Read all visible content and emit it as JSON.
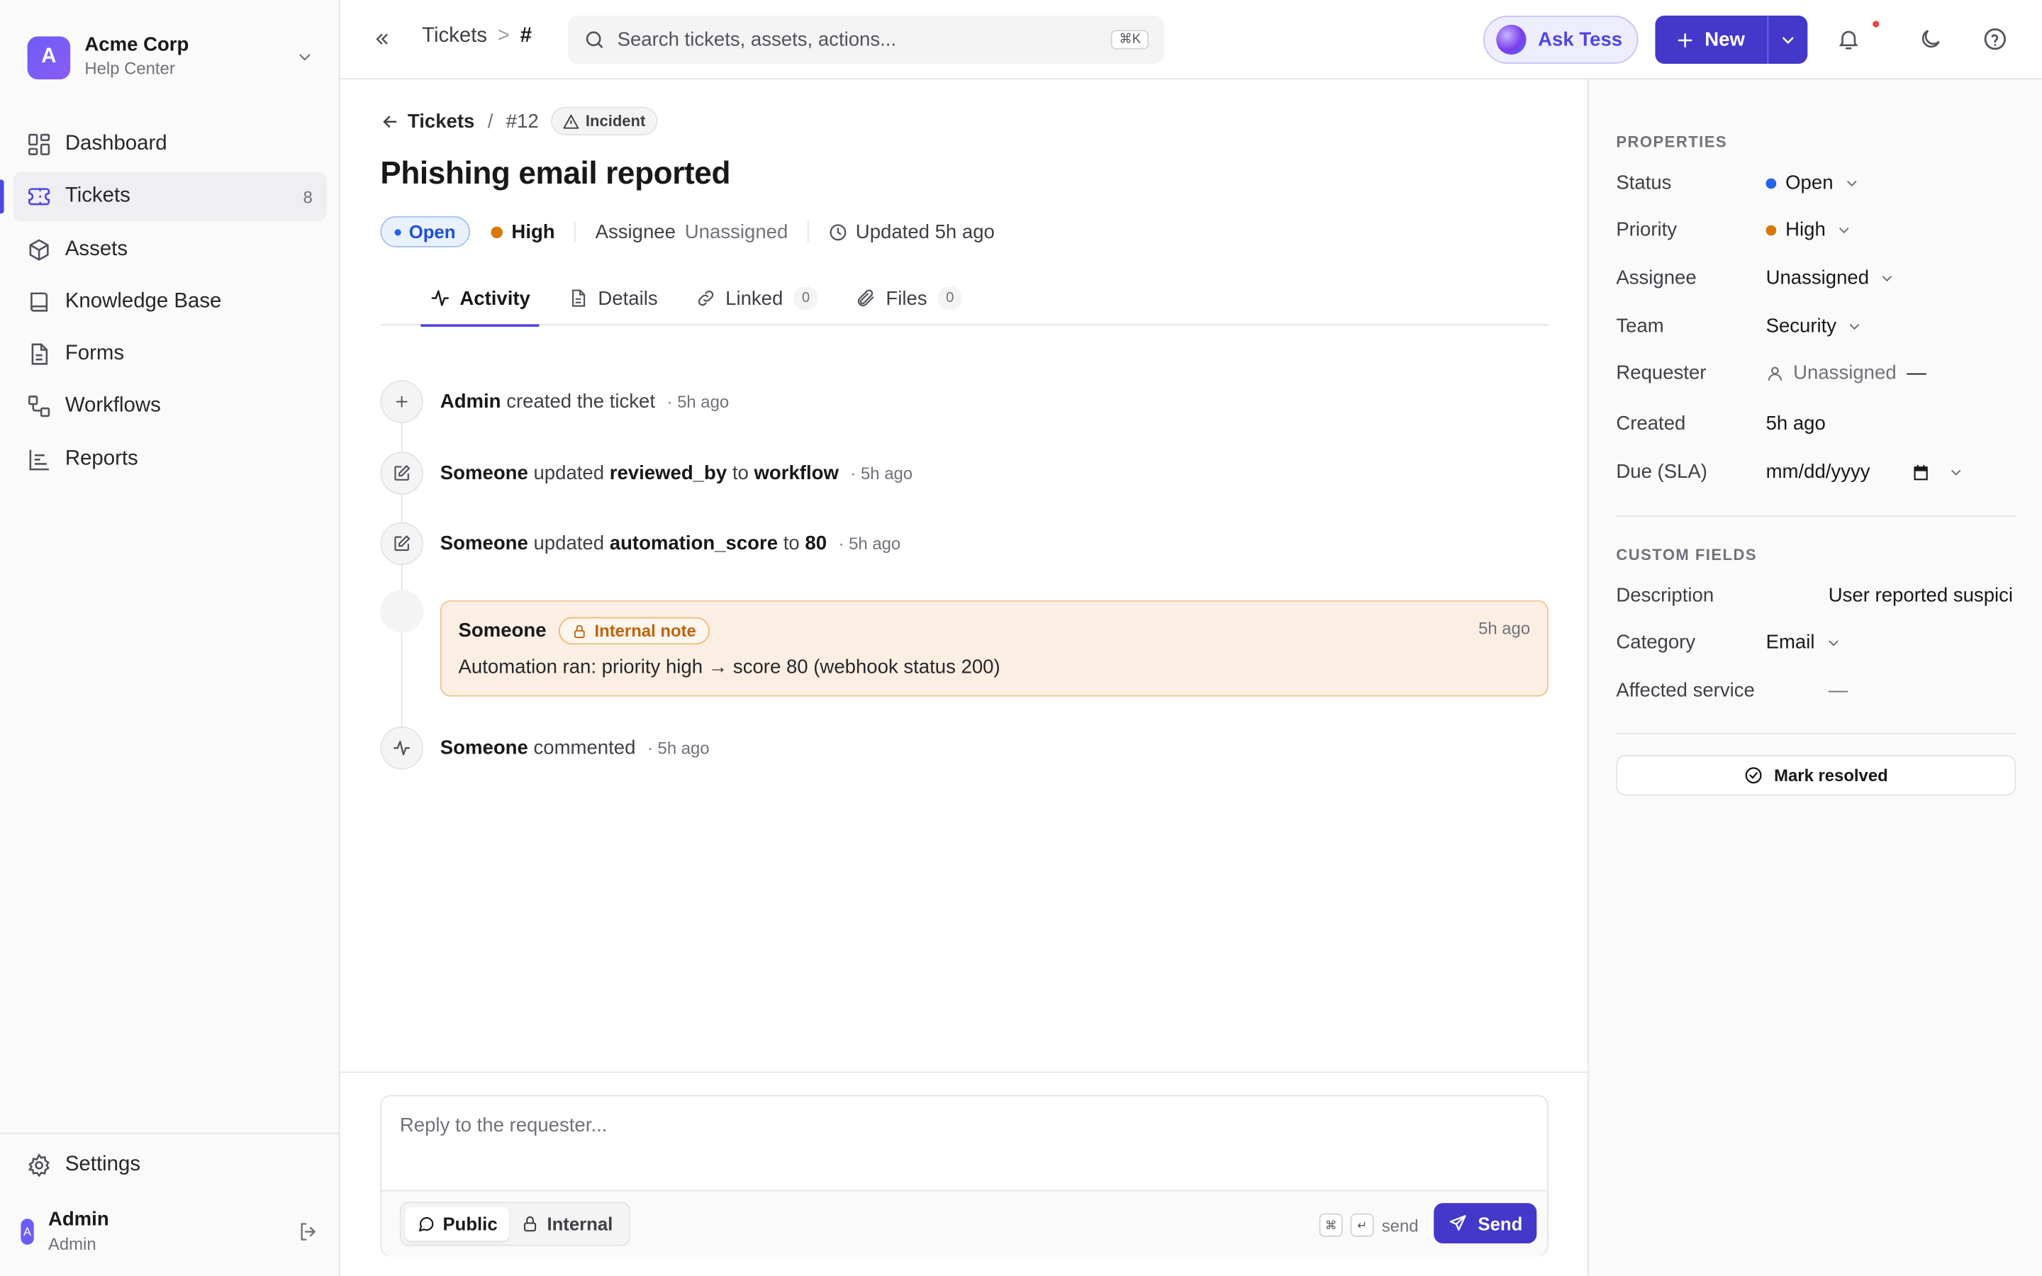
{
  "org": {
    "initial": "A",
    "name": "Acme Corp",
    "subtitle": "Help Center"
  },
  "nav": [
    {
      "label": "Dashboard",
      "icon": "dashboard-icon"
    },
    {
      "label": "Tickets",
      "icon": "ticket-icon",
      "count": "8",
      "active": true
    },
    {
      "label": "Assets",
      "icon": "box-icon"
    },
    {
      "label": "Knowledge Base",
      "icon": "book-icon"
    },
    {
      "label": "Forms",
      "icon": "file-icon"
    },
    {
      "label": "Workflows",
      "icon": "workflow-icon"
    },
    {
      "label": "Reports",
      "icon": "chart-icon"
    }
  ],
  "settings_label": "Settings",
  "user": {
    "initial": "A",
    "name": "Admin",
    "role": "Admin"
  },
  "topbar": {
    "crumb_tickets": "Tickets",
    "crumb_sep": ">",
    "crumb_current": "#",
    "search_placeholder": "Search tickets, assets, actions...",
    "search_kbd": "⌘K",
    "ask_label": "Ask Tess",
    "new_label": "New"
  },
  "ticket": {
    "back_label": "Tickets",
    "slash": "/",
    "number": "#12",
    "type_tag": "Incident",
    "title": "Phishing email reported",
    "status": "Open",
    "priority": "High",
    "assignee_label": "Assignee",
    "assignee_value": "Unassigned",
    "updated": "Updated 5h ago"
  },
  "tabs": [
    {
      "label": "Activity",
      "icon": "activity-icon",
      "active": true
    },
    {
      "label": "Details",
      "icon": "document-icon"
    },
    {
      "label": "Linked",
      "icon": "link-icon",
      "badge": "0"
    },
    {
      "label": "Files",
      "icon": "paperclip-icon",
      "badge": "0"
    }
  ],
  "events": [
    {
      "actor": "Admin",
      "text": "created the ticket",
      "time": "· 5h ago"
    },
    {
      "actor": "Someone",
      "pre": "updated",
      "field": "reviewed_by",
      "mid": "to",
      "value": "workflow",
      "time": "· 5h ago"
    },
    {
      "actor": "Someone",
      "pre": "updated",
      "field": "automation_score",
      "mid": "to",
      "value": "80",
      "time": "· 5h ago"
    },
    {
      "actor": "Someone",
      "text": "commented",
      "time": "· 5h ago"
    }
  ],
  "note": {
    "actor": "Someone",
    "tag": "Internal note",
    "time": "5h ago",
    "body": "Automation ran: priority high → score 80 (webhook status 200)"
  },
  "composer": {
    "placeholder": "Reply to the requester...",
    "public_label": "Public",
    "internal_label": "Internal",
    "key_cmd": "⌘",
    "key_enter": "↵",
    "hint": "send",
    "send_label": "Send"
  },
  "properties": {
    "title": "PROPERTIES",
    "status_label": "Status",
    "status_value": "Open",
    "priority_label": "Priority",
    "priority_value": "High",
    "assignee_label": "Assignee",
    "assignee_value": "Unassigned",
    "team_label": "Team",
    "team_value": "Security",
    "requester_label": "Requester",
    "requester_value": "Unassigned",
    "requester_dash": "—",
    "created_label": "Created",
    "created_value": "5h ago",
    "due_label": "Due (SLA)",
    "due_placeholder": "mm/dd/yyyy"
  },
  "custom_fields": {
    "title": "CUSTOM FIELDS",
    "description_label": "Description",
    "description_value": "User reported suspici",
    "category_label": "Category",
    "category_value": "Email",
    "affected_label": "Affected service",
    "affected_value": "—"
  },
  "resolve_label": "Mark resolved",
  "colors": {
    "accent": "#4338ca",
    "status_open": "#2563eb",
    "priority_high": "#d97706",
    "note_bg": "#fbeee2"
  }
}
